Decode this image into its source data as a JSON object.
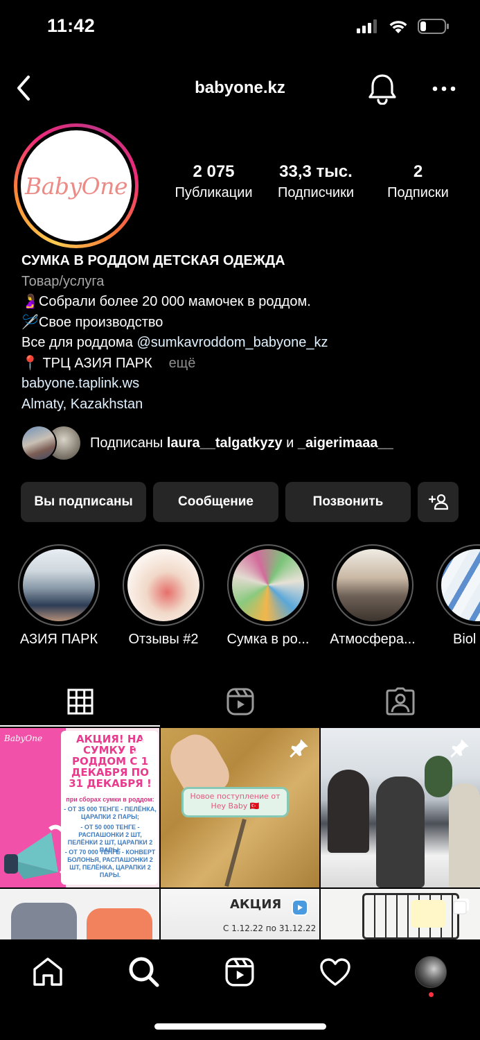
{
  "status_bar": {
    "time": "11:42"
  },
  "header": {
    "username": "babyone.kz"
  },
  "profile": {
    "avatar_logo": "BabyOne",
    "stats": [
      {
        "value": "2 075",
        "label": "Публикации"
      },
      {
        "value": "33,3 тыс.",
        "label": "Подписчики"
      },
      {
        "value": "2",
        "label": "Подписки"
      }
    ],
    "bio": {
      "title": "СУМКА В РОДДОМ  ДЕТСКАЯ ОДЕЖДА",
      "category": "Товар/услуга",
      "line1_emoji": "🤰",
      "line1": "Собрали более 20 000 мамочек в роддом.",
      "line2_emoji": "🪡",
      "line2": "Свое производство",
      "line3_text": "Все для роддома ",
      "line3_mention": "@sumkavroddom_babyone_kz",
      "line4_emoji": "📍",
      "line4": " ТРЦ АЗИЯ ПАРК",
      "more": "ещё",
      "link": "babyone.taplink.ws",
      "location": "Almaty, Kazakhstan"
    },
    "followed_by": {
      "prefix": "Подписаны ",
      "user1": "laura__talgatkyzy",
      "joiner": " и ",
      "user2": "_aigerimaaa__"
    }
  },
  "actions": {
    "following": "Вы подписаны",
    "message": "Сообщение",
    "call": "Позвонить"
  },
  "highlights": [
    {
      "label": "АЗИЯ ПАРК"
    },
    {
      "label": "Отзывы #2"
    },
    {
      "label": "Сумка в ро..."
    },
    {
      "label": "Атмосфера..."
    },
    {
      "label": "Biol"
    }
  ],
  "posts": {
    "post1": {
      "logo": "BabyOne",
      "title": "АКЦИЯ! НА СУМКУ В РОДДОМ С 1 ДЕКАБРЯ ПО 31 ДЕКАБРЯ !",
      "subtitle": "при сборах сумки в роддом:",
      "tier1": "- ОТ 35 000 ТЕНГЕ - ПЕЛЁНКА, ЦАРАПКИ 2 ПАРЫ;",
      "tier2": "- ОТ 50 000 ТЕНГЕ - РАСПАШОНКИ 2 ШТ, ПЕЛЁНКИ 2 ШТ, ЦАРАПКИ 2 ПАРЫ;",
      "tier3": "- ОТ 70 000 ТЕНГЕ - КОНВЕРТ БОЛОНЬЯ, РАСПАШОНКИ 2 ШТ, ПЕЛЁНКА, ЦАРАПКИ 2 ПАРЫ."
    },
    "post2": {
      "bubble": "Новое поступление от Hey Baby 🇹🇷"
    },
    "post5": {
      "title": "АКЦИЯ",
      "dates": "С 1.12.22 по 31.12.22"
    }
  },
  "colors": {
    "accent_pink": "#e83b8d",
    "button_bg": "#262626",
    "link": "#e0f1ff",
    "notification_dot": "#ff3040"
  }
}
